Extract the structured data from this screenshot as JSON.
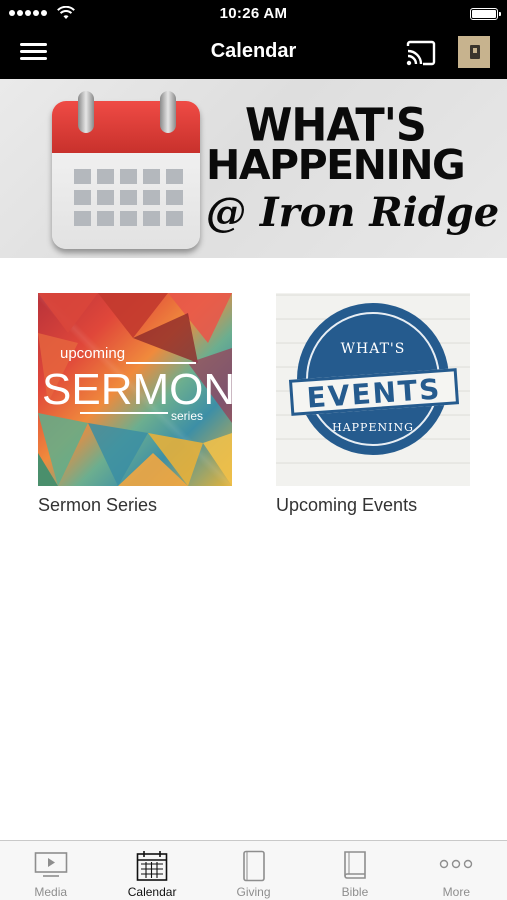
{
  "status_bar": {
    "time": "10:26 AM"
  },
  "nav_bar": {
    "title": "Calendar"
  },
  "banner": {
    "line1": "WHAT'S",
    "line2": "HAPPENING",
    "line3": "@ Iron Ridge"
  },
  "tiles": [
    {
      "label": "Sermon Series",
      "thumb": {
        "top": "upcoming",
        "main": "SERMON",
        "bottom": "series"
      }
    },
    {
      "label": "Upcoming Events",
      "thumb": {
        "top": "WHAT'S",
        "main": "EVENTS",
        "bottom": "HAPPENING"
      }
    }
  ],
  "tab_bar": {
    "active": "Calendar",
    "tabs": [
      {
        "label": "Media",
        "icon": "media-icon"
      },
      {
        "label": "Calendar",
        "icon": "calendar-icon"
      },
      {
        "label": "Giving",
        "icon": "giving-icon"
      },
      {
        "label": "Bible",
        "icon": "bible-icon"
      },
      {
        "label": "More",
        "icon": "more-icon"
      }
    ]
  },
  "colors": {
    "nav_background": "#000000",
    "events_blue": "#255b8e",
    "app_icon_tan": "#c7b38e"
  }
}
